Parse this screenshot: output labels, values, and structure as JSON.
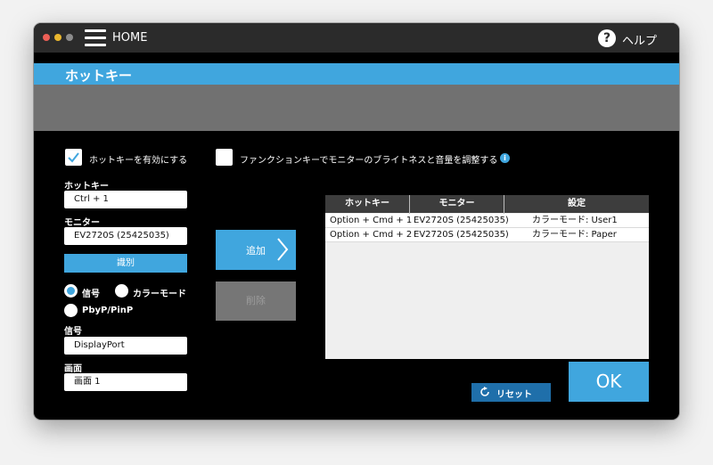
{
  "header": {
    "home_label": "HOME",
    "help_label": "ヘルプ",
    "help_icon": "?"
  },
  "page": {
    "title": "ホットキー"
  },
  "options": {
    "enable_hotkey_label": "ホットキーを有効にする",
    "enable_hotkey_checked": true,
    "function_key_label": "ファンクションキーでモニターのブライトネスと音量を調整する",
    "function_key_checked": false,
    "info_icon": "i"
  },
  "form": {
    "hotkey_label": "ホットキー",
    "hotkey_value": "Ctrl + 1",
    "monitor_label": "モニター",
    "monitor_value": "EV2720S (25425035)",
    "identify_label": "識別",
    "radio_signal_label": "信号",
    "radio_color_mode_label": "カラーモード",
    "radio_pbyp_label": "PbyP/PinP",
    "radio_selected": "signal",
    "signal_label": "信号",
    "signal_value": "DisplayPort",
    "screen_label": "画面",
    "screen_value": "画面 1"
  },
  "actions": {
    "add_label": "追加",
    "delete_label": "削除",
    "reset_label": "リセット",
    "ok_label": "OK"
  },
  "table": {
    "headers": [
      "ホットキー",
      "モニター",
      "設定"
    ],
    "rows": [
      [
        "Option + Cmd + 1",
        "EV2720S (25425035)",
        "カラーモード: User1"
      ],
      [
        "Option + Cmd + 2",
        "EV2720S (25425035)",
        "カラーモード: Paper"
      ]
    ]
  },
  "colors": {
    "accent": "#40a6de",
    "titlebar": "#2b2b2b",
    "band": "#717171",
    "reset": "#1f6faa"
  }
}
